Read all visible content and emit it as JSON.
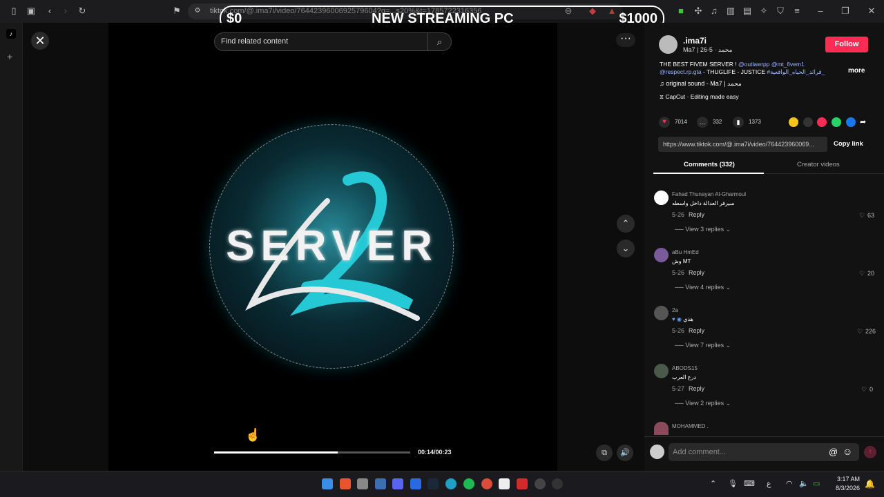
{
  "browser": {
    "url": "tiktok.com/@.ima7i/video/7644239600692579604?q=...s20%&t=1785722316356"
  },
  "overlay": {
    "left_price": "$0",
    "title": "NEW STREAMING PC",
    "right_price": "$1000"
  },
  "player": {
    "search_placeholder": "Find related content",
    "logo_text": "SERVER",
    "time": "00:14/00:23",
    "progress": 0.63
  },
  "author": {
    "name": ".ima7i",
    "meta": "Ma7 | محمد · 5-26",
    "follow_label": "Follow",
    "caption_line1_plain": "THE BEST FIVEM SERVER ! ",
    "caption_line1_links": "@outlawrpp @mt_fivem1",
    "caption_line2_link": "@respect.rp.gta",
    "caption_line2_plain": " - THUGLIFE - JUSTICE ",
    "caption_line2_tag": "#قرائد_الحياه_الواقعية_...",
    "more_label": "more",
    "sound": "original sound - Ma7 | محمد",
    "capcut": "CapCut · Editing made easy"
  },
  "stats": {
    "likes": "7014",
    "comments": "332",
    "saves": "1373"
  },
  "share": {
    "link": "https://www.tiktok.com/@.ima7i/video/764423960069...",
    "copy_label": "Copy link"
  },
  "tabs": {
    "comments": "Comments (332)",
    "creator": "Creator videos"
  },
  "comments": [
    {
      "name": "Fahad Thunayan Al-Gharmoul",
      "text": "سيرفر العدالة داخل واسطه",
      "date": "5-26",
      "reply": "Reply",
      "likes": "63",
      "view": "View 3 replies"
    },
    {
      "name": "aBu HmEd",
      "text": "وش MT",
      "date": "5-26",
      "reply": "Reply",
      "likes": "20",
      "view": "View 4 replies"
    },
    {
      "name": "2a",
      "text": "هذي",
      "date": "5-26",
      "reply": "Reply",
      "likes": "226",
      "view": "View 7 replies"
    },
    {
      "name": "ABODS15",
      "text": "درع العرب",
      "date": "5-27",
      "reply": "Reply",
      "likes": "0",
      "view": "View 2 replies"
    },
    {
      "name": "MOHAMMED .",
      "text": "",
      "date": "",
      "reply": "",
      "likes": "",
      "view": ""
    }
  ],
  "comment_input": {
    "placeholder": "Add comment..."
  },
  "taskbar": {
    "lang": "ع",
    "time": "3:17 AM",
    "date": "8/3/2026"
  },
  "colors": {
    "accent": "#fe2c55",
    "cyan": "#25c9d6",
    "link": "#9db7ff"
  }
}
